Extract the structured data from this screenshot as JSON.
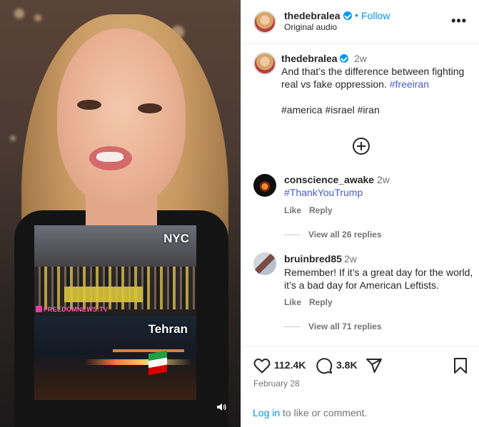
{
  "video": {
    "inset_top_label": "NYC",
    "inset_bottom_label": "Tehran",
    "watermark": "FREEDOMNEWS.TV"
  },
  "header": {
    "username": "thedebralea",
    "separator": "•",
    "follow_label": "Follow",
    "audio": "Original audio",
    "more_label": "•••"
  },
  "caption": {
    "username": "thedebralea",
    "age": "2w",
    "text": "And that’s the difference between fighting real vs fake oppression.",
    "inline_tag": "#freeiran",
    "tags": "#america #israel #iran"
  },
  "comments": [
    {
      "username": "conscience_awake",
      "age": "2w",
      "text": "#ThankYouTrump",
      "like_label": "Like",
      "reply_label": "Reply",
      "view_replies": "View all 26 replies"
    },
    {
      "username": "bruinbred85",
      "age": "2w",
      "text": "Remember! If it’s a great day for the world, it’s a bad day for American Leftists.",
      "like_label": "Like",
      "reply_label": "Reply",
      "view_replies": "View all 71 replies"
    }
  ],
  "footer": {
    "likes": "112.4K",
    "comments_count": "3.8K",
    "date": "February 28",
    "login_link": "Log in",
    "login_suffix": " to like or comment."
  },
  "colors": {
    "link_blue": "#0095f6",
    "hashtag": "#4a5bd4",
    "muted": "#737373",
    "text": "#262626"
  },
  "icons": [
    "verified-badge-icon",
    "more-options-icon",
    "add-comment-icon",
    "heart-icon",
    "comment-icon",
    "share-icon",
    "bookmark-icon",
    "sound-icon"
  ]
}
